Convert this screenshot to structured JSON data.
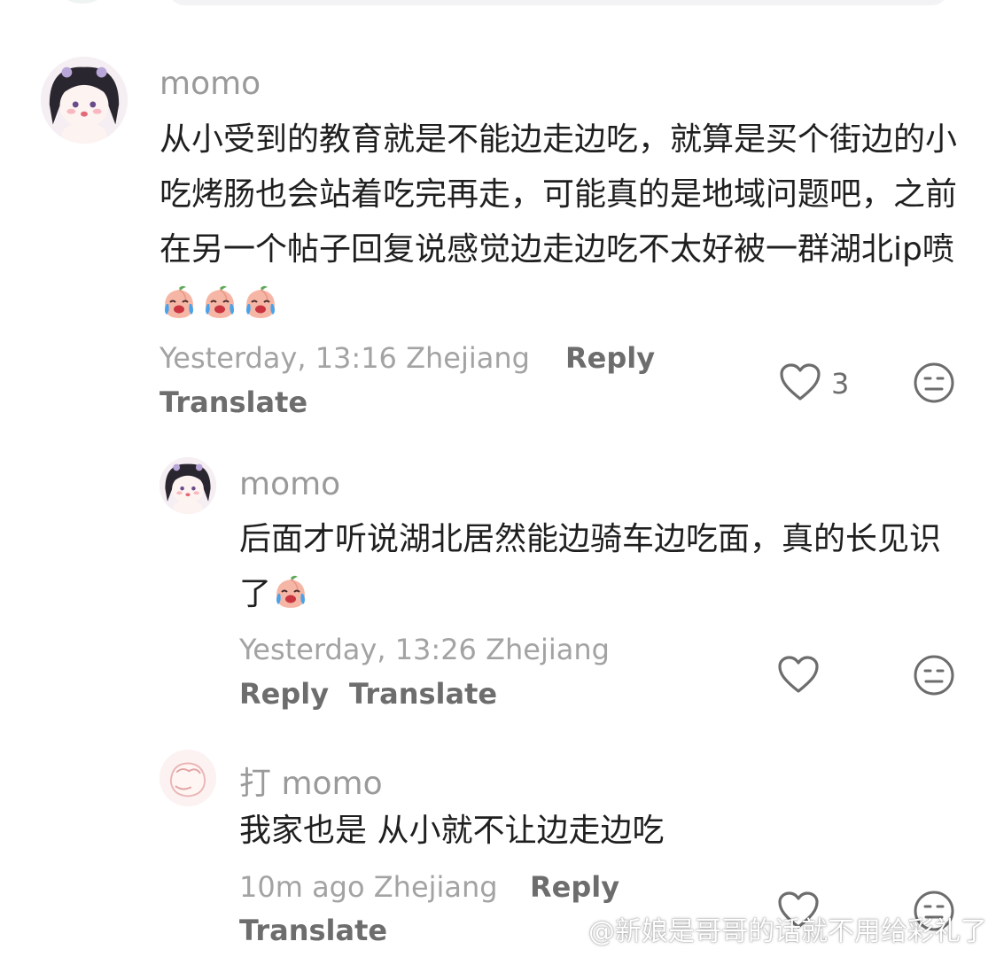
{
  "colors": {
    "text": "#1f1f1f",
    "author": "#9a9a9a",
    "meta": "#a3a3a3",
    "action": "#6d6d6d"
  },
  "comments": [
    {
      "author": "momo",
      "text": "从小受到的教育就是不能边走边吃，就算是买个街边的小吃烤肠也会站着吃完再走，可能真的是地域问题吧，之前在另一个帖子回复说感觉边走边吃不太好被一群湖北ip喷",
      "emoji_icon": "crying-peach-emoji",
      "emoji_count": 3,
      "meta": "Yesterday, 13:16 Zhejiang",
      "reply_label": "Reply",
      "translate_label": "Translate",
      "like_count": "3"
    },
    {
      "author": "momo",
      "text": "后面才听说湖北居然能边骑车边吃面，真的长见识了",
      "emoji_icon": "crying-peach-emoji",
      "emoji_count": 1,
      "meta": "Yesterday, 13:26 Zhejiang",
      "reply_label": "Reply",
      "translate_label": "Translate",
      "like_count": ""
    },
    {
      "author": "打 momo",
      "text": "我家也是 从小就不让边走边吃",
      "meta": "10m ago Zhejiang",
      "reply_label": "Reply",
      "translate_label": "Translate",
      "like_count": ""
    }
  ],
  "icons": {
    "like": "heart-outline-icon",
    "dislike": "meh-face-icon"
  },
  "watermark": {
    "icon": "weibo-logo-icon",
    "text": "@新娘是哥哥的话就不用给彩礼了"
  }
}
